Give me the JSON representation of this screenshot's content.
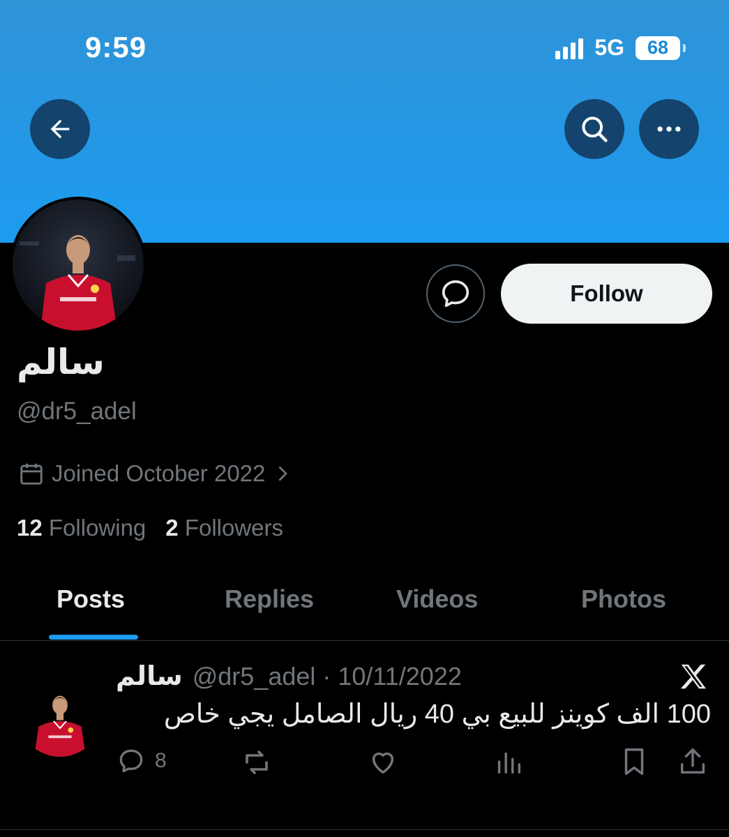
{
  "status_bar": {
    "time": "9:59",
    "network": "5G",
    "battery": "68"
  },
  "header": {
    "back_icon": "arrow-left-icon",
    "search_icon": "search-icon",
    "more_icon": "more-horizontal-icon"
  },
  "profile": {
    "display_name": "سالم",
    "handle": "@dr5_adel",
    "joined": "Joined October 2022",
    "following_count": "12",
    "following_label": "Following",
    "followers_count": "2",
    "followers_label": "Followers",
    "follow_label": "Follow",
    "message_icon": "message-bubble-icon"
  },
  "tabs": [
    {
      "label": "Posts",
      "active": true
    },
    {
      "label": "Replies",
      "active": false
    },
    {
      "label": "Videos",
      "active": false
    },
    {
      "label": "Photos",
      "active": false
    }
  ],
  "post": {
    "name": "سالم",
    "meta": "@dr5_adel · 10/11/2022",
    "text": "100 الف كوينز للبيع بي 40 ريال الصامل يجي خاص",
    "reply_count": "8",
    "icons": [
      "reply-icon",
      "repost-icon",
      "like-icon",
      "views-icon",
      "bookmark-icon",
      "share-icon",
      "x-logo-icon"
    ]
  },
  "colors": {
    "banner": "#1d9bf0",
    "accent": "#1d9bf0",
    "muted": "#71767b",
    "background": "#000000",
    "follow_button": "#eff3f4"
  }
}
